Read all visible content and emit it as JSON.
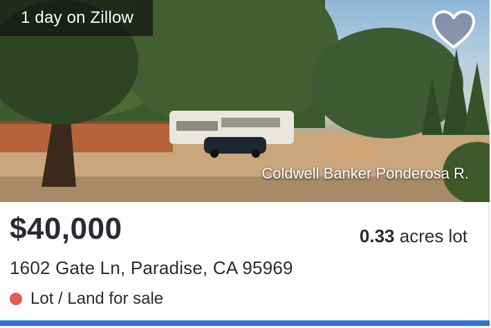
{
  "listing": {
    "days_on_zillow": "1 day on Zillow",
    "photo_credit": "Coldwell Banker Ponderosa R.",
    "price": "$40,000",
    "lot_size_value": "0.33",
    "lot_size_unit": "acres lot",
    "address": "1602 Gate Ln, Paradise, CA 95969",
    "status": "Lot / Land for sale",
    "status_color": "#e8594e",
    "favorite_icon": "heart-icon",
    "accent_color": "#2f6fe0"
  }
}
